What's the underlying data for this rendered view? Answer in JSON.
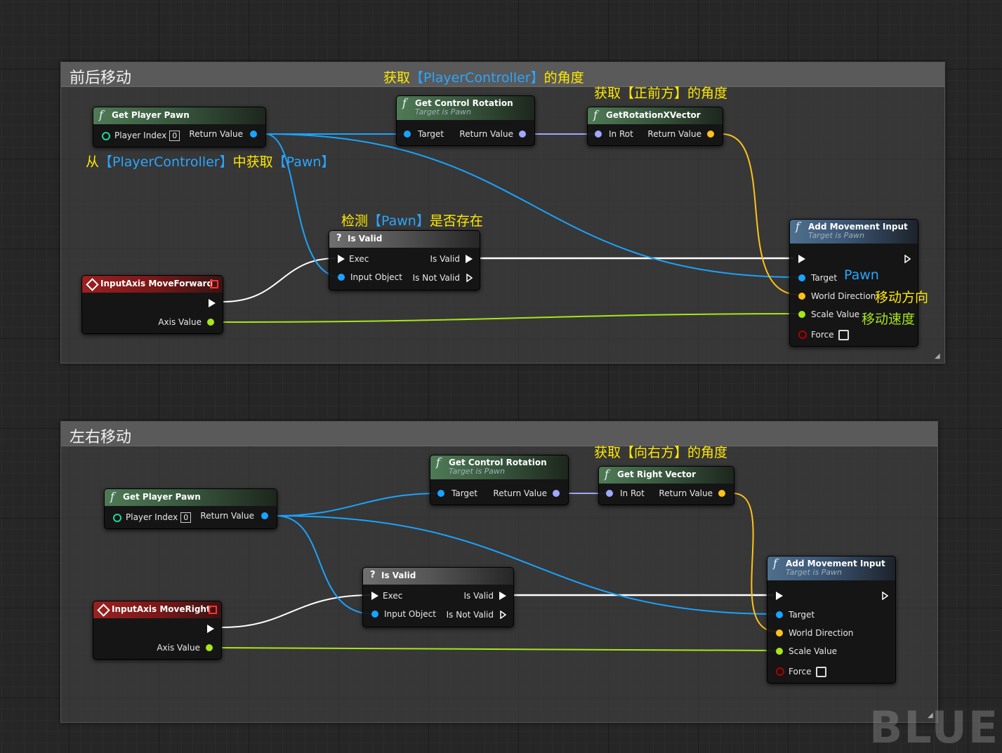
{
  "groups": [
    {
      "title": "前后移动",
      "annotations": {
        "get_controller_angle": {
          "p1": "获取",
          "p2": "【PlayerController】",
          "p3": "的角度"
        },
        "get_forward_angle": "获取【正前方】的角度",
        "from_controller": {
          "p1": "从",
          "p2": "【PlayerController】",
          "p3": "中获取",
          "p4": "【Pawn】"
        },
        "check_pawn": {
          "p1": "检测",
          "p2": "【Pawn】",
          "p3": "是否存在"
        },
        "pawn": "Pawn",
        "move_direction": "移动方向",
        "move_speed": "移动速度"
      },
      "nodes": {
        "get_player_pawn": {
          "title": "Get Player Pawn",
          "player_index": "Player Index",
          "index_value": "0",
          "return_value": "Return Value"
        },
        "get_control_rotation": {
          "title": "Get Control Rotation",
          "subtitle": "Target is Pawn",
          "target": "Target",
          "return_value": "Return Value"
        },
        "vector_node": {
          "title": "GetRotationXVector",
          "in_rot": "In Rot",
          "return_value": "Return Value"
        },
        "is_valid": {
          "title": "Is Valid",
          "exec": "Exec",
          "is_valid": "Is Valid",
          "input_object": "Input Object",
          "is_not_valid": "Is Not Valid"
        },
        "input_axis": {
          "title": "InputAxis MoveForward",
          "axis_value": "Axis Value"
        },
        "add_movement": {
          "title": "Add Movement Input",
          "subtitle": "Target is Pawn",
          "target": "Target",
          "world_direction": "World Direction",
          "scale_value": "Scale Value",
          "force": "Force"
        }
      }
    },
    {
      "title": "左右移动",
      "annotations": {
        "get_right_angle": "获取【向右方】的角度"
      },
      "nodes": {
        "get_player_pawn": {
          "title": "Get Player Pawn",
          "player_index": "Player Index",
          "index_value": "0",
          "return_value": "Return Value"
        },
        "get_control_rotation": {
          "title": "Get Control Rotation",
          "subtitle": "Target is Pawn",
          "target": "Target",
          "return_value": "Return Value"
        },
        "vector_node": {
          "title": "Get Right Vector",
          "in_rot": "In Rot",
          "return_value": "Return Value"
        },
        "is_valid": {
          "title": "Is Valid",
          "exec": "Exec",
          "is_valid": "Is Valid",
          "input_object": "Input Object",
          "is_not_valid": "Is Not Valid"
        },
        "input_axis": {
          "title": "InputAxis MoveRight",
          "axis_value": "Axis Value"
        },
        "add_movement": {
          "title": "Add Movement Input",
          "subtitle": "Target is Pawn",
          "target": "Target",
          "world_direction": "World Direction",
          "scale_value": "Scale Value",
          "force": "Force"
        }
      }
    }
  ],
  "watermark": "BLUEPR",
  "colors": {
    "object_pin": "#1aa3ff",
    "vector_pin": "#ffc21a",
    "rotator_pin": "#a0a8ff",
    "float_pin": "#a7e61a",
    "exec_pin": "#ffffff",
    "function_header": "#3a5a40",
    "target_header": "#3b5573",
    "event_header": "#7a1818",
    "annotation_yellow": "#ffea00",
    "annotation_blue": "#2aa6ff",
    "annotation_green": "#a7e61a"
  }
}
